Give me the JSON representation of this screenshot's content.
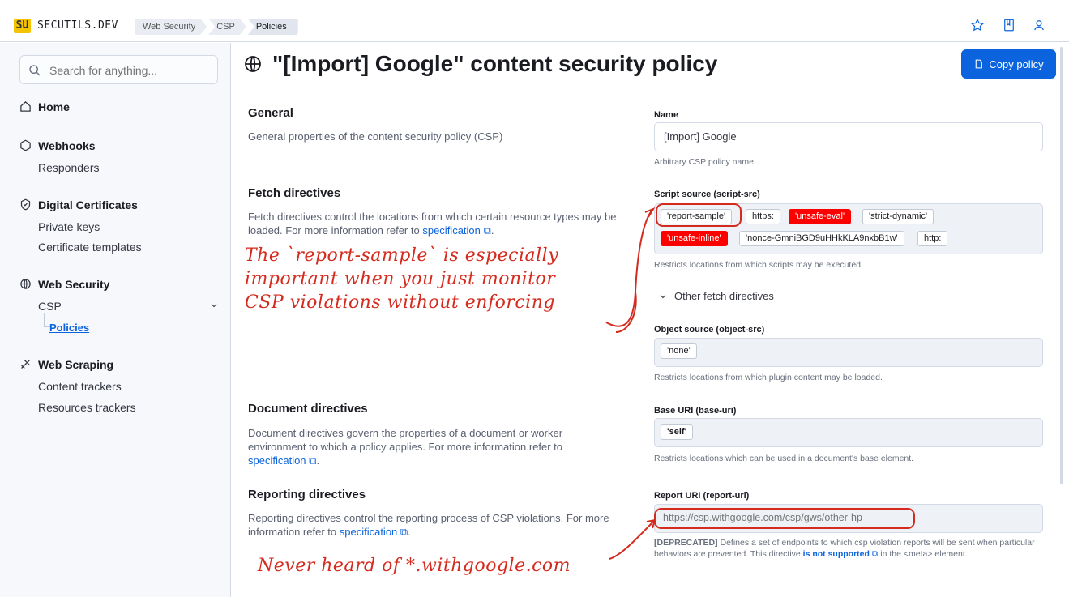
{
  "header": {
    "logo_badge": "SU",
    "logo_text": "SECUTILS.DEV",
    "breadcrumbs": [
      "Web Security",
      "CSP",
      "Policies"
    ],
    "icons": [
      "star-icon",
      "book-icon",
      "user-icon"
    ]
  },
  "sidebar": {
    "search_placeholder": "Search for anything...",
    "sections": [
      {
        "label": "Home",
        "icon": "home-icon"
      },
      {
        "label": "Webhooks",
        "icon": "hexagon-icon",
        "items": [
          "Responders"
        ]
      },
      {
        "label": "Digital Certificates",
        "icon": "certificate-icon",
        "items": [
          "Private keys",
          "Certificate templates"
        ]
      },
      {
        "label": "Web Security",
        "icon": "globe-icon",
        "items": [
          "CSP"
        ],
        "subitems": [
          "Policies"
        ]
      },
      {
        "label": "Web Scraping",
        "icon": "scraper-icon",
        "items": [
          "Content trackers",
          "Resources trackers"
        ]
      }
    ]
  },
  "main": {
    "title": "\"[Import] Google\" content security policy",
    "copy_button": "Copy policy",
    "general": {
      "title": "General",
      "desc": "General properties of the content security policy (CSP)",
      "name_label": "Name",
      "name_value": "[Import] Google",
      "name_help": "Arbitrary CSP policy name."
    },
    "fetch": {
      "title": "Fetch directives",
      "desc": "Fetch directives control the locations from which certain resource types may be loaded. For more information refer to",
      "link": "specification",
      "script_label": "Script source (script-src)",
      "script_pills": [
        "'report-sample'",
        "https:",
        "'unsafe-eval'",
        "'strict-dynamic'",
        "'unsafe-inline'",
        "'nonce-GmniBGD9uHHkKLA9nxbB1w'",
        "http:"
      ],
      "script_help": "Restricts locations from which scripts may be executed.",
      "other_label": "Other fetch directives",
      "object_label": "Object source (object-src)",
      "object_pills": [
        "'none'"
      ],
      "object_help": "Restricts locations from which plugin content may be loaded."
    },
    "document": {
      "title": "Document directives",
      "desc": "Document directives govern the properties of a document or worker environment to which a policy applies. For more information refer to",
      "link": "specification",
      "base_label": "Base URI (base-uri)",
      "base_pills": [
        "'self'"
      ],
      "base_help": "Restricts locations which can be used in a document's base element."
    },
    "reporting": {
      "title": "Reporting directives",
      "desc": "Reporting directives control the reporting process of CSP violations. For more information refer to",
      "link": "specification",
      "report_label": "Report URI (report-uri)",
      "report_value": "https://csp.withgoogle.com/csp/gws/other-hp",
      "report_help_prefix": "[DEPRECATED]",
      "report_help_1": "Defines a set of endpoints to which csp violation reports will be sent when particular behaviors are prevented. This directive",
      "report_help_link": "is not supported",
      "report_help_2": "in the <meta> element."
    }
  },
  "annotations": {
    "note_1_line_1": "The `report-sample` is especially",
    "note_1_line_2": "important when you just monitor",
    "note_1_line_3": "CSP violations without enforcing",
    "note_2": "Never heard of *.withgoogle.com"
  }
}
